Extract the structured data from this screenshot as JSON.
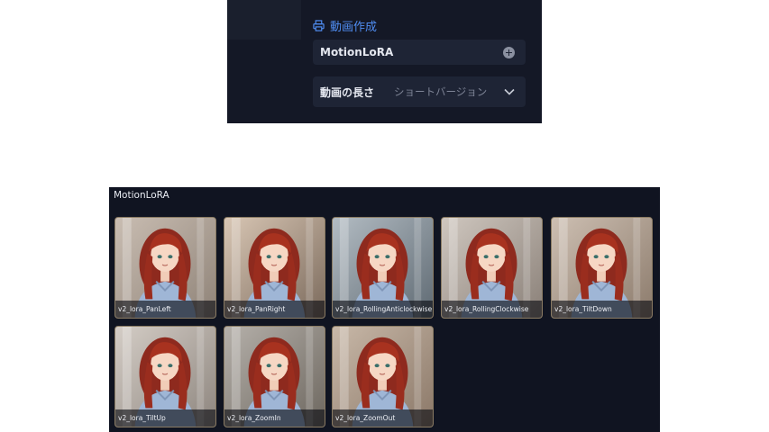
{
  "top_panel": {
    "section_title": "動画作成",
    "section_icon": "printer-icon",
    "motion_lora_label": "MotionLoRA",
    "add_icon": "plus-circle-icon",
    "length_label": "動画の長さ",
    "length_value": "ショートバージョン",
    "dropdown_icon": "chevron-down-icon",
    "accent_color": "#4f8cf0"
  },
  "motion_panel": {
    "title": "MotionLoRA",
    "items": [
      {
        "label": "v2_lora_PanLeft"
      },
      {
        "label": "v2_lora_PanRight"
      },
      {
        "label": "v2_lora_RollingAnticlockwise"
      },
      {
        "label": "v2_lora_RollingClockwise"
      },
      {
        "label": "v2_lora_TiltDown"
      },
      {
        "label": "v2_lora_TiltUp"
      },
      {
        "label": "v2_lora_ZoomIn"
      },
      {
        "label": "v2_lora_ZoomOut"
      }
    ]
  }
}
